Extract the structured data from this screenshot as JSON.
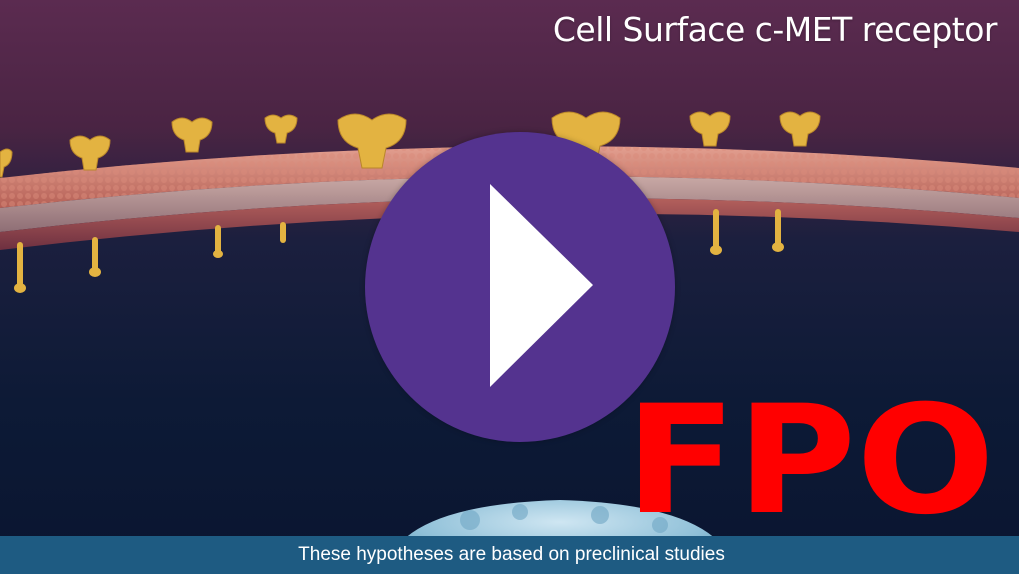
{
  "video": {
    "title": "Cell Surface c-MET receptor",
    "caption": "These hypotheses are based on preclinical studies",
    "watermark": "FPO",
    "play_icon": "play-triangle-icon"
  },
  "colors": {
    "play_button": "#54338f",
    "watermark": "#ff0000",
    "caption_bar": "#1e5b82",
    "membrane": "#c67a6a",
    "receptor": "#e3b341",
    "background_deep": "#0b1833",
    "background_top": "#5a2a4f"
  }
}
